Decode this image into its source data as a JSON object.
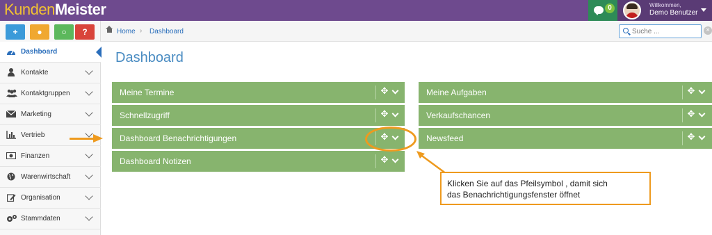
{
  "app": {
    "logo_part1": "Kunden",
    "logo_part2": "Meister",
    "brand_color": "#6e4a8e",
    "accent_color": "#ee9a1e"
  },
  "header": {
    "chat_badge": "0",
    "chat_icon": "comment-icon",
    "welcome_text": "Willkommen,",
    "user_name": "Demo Benutzer"
  },
  "quick_actions": [
    {
      "icon": "plus-icon",
      "glyph": "+"
    },
    {
      "icon": "chat-bubble-icon",
      "glyph": "●"
    },
    {
      "icon": "search-icon",
      "glyph": "○"
    },
    {
      "icon": "help-icon",
      "glyph": "?"
    }
  ],
  "sidebar": {
    "items": [
      {
        "label": "Dashboard",
        "icon": "dashboard-icon",
        "active": true
      },
      {
        "label": "Kontakte",
        "icon": "person-icon"
      },
      {
        "label": "Kontaktgruppen",
        "icon": "group-icon"
      },
      {
        "label": "Marketing",
        "icon": "envelope-icon"
      },
      {
        "label": "Vertrieb",
        "icon": "bar-chart-icon"
      },
      {
        "label": "Finanzen",
        "icon": "money-icon"
      },
      {
        "label": "Warenwirtschaft",
        "icon": "globe-icon"
      },
      {
        "label": "Organisation",
        "icon": "edit-icon"
      },
      {
        "label": "Stammdaten",
        "icon": "cogs-icon"
      }
    ]
  },
  "breadcrumb": {
    "home": "Home",
    "separator": "›",
    "current": "Dashboard"
  },
  "search": {
    "placeholder": "Suche ..."
  },
  "main": {
    "title": "Dashboard",
    "widgets_left": [
      "Meine Termine",
      "Schnellzugriff",
      "Dashboard Benachrichtigungen",
      "Dashboard Notizen"
    ],
    "widgets_right": [
      "Meine Aufgaben",
      "Verkaufschancen",
      "Newsfeed"
    ],
    "widget_color": "#87b46e"
  },
  "annotation": {
    "line1": "Klicken Sie auf das Pfeilsymbol , damit sich",
    "line2": "das Benachrichtigungsfenster öffnet"
  }
}
